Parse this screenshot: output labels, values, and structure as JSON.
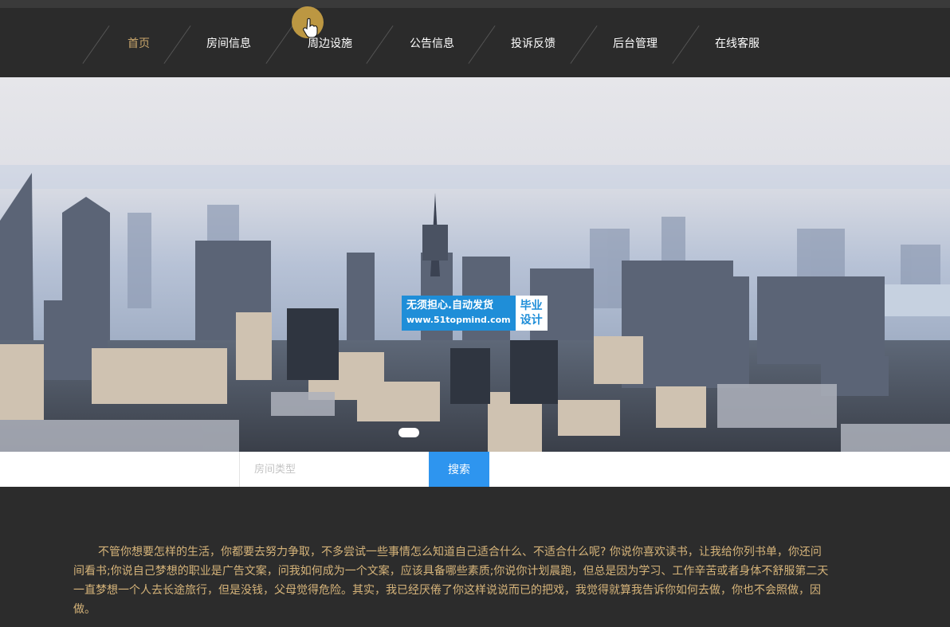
{
  "nav": {
    "items": [
      {
        "label": "首页",
        "active": true
      },
      {
        "label": "房间信息"
      },
      {
        "label": "周边设施"
      },
      {
        "label": "公告信息"
      },
      {
        "label": "投诉反馈"
      },
      {
        "label": "后台管理"
      },
      {
        "label": "在线客服"
      }
    ]
  },
  "watermark": {
    "line1": "无须担心.自动发货",
    "line2": "www.51topmind.com",
    "badge_line1": "毕业",
    "badge_line2": "设计"
  },
  "search": {
    "placeholder": "房间类型",
    "button_label": "搜索"
  },
  "intro": {
    "lines": [
      "不管你想要怎样的生活，你都要去努力争取，不多尝试一些事情怎么知道自己适合什么、不适合什么呢? 你说你喜欢读书，让我给你列书单，你还问",
      "间看书;你说自己梦想的职业是广告文案，问我如何成为一个文案，应该具备哪些素质;你说你计划晨跑，但总是因为学习、工作辛苦或者身体不舒服第二天",
      "一直梦想一个人去长途旅行，但是没钱，父母觉得危险。其实，我已经厌倦了你这样说说而已的把戏，我觉得就算我告诉你如何去做，你也不会照做，因",
      "做。"
    ]
  },
  "colors": {
    "nav_bg": "#2b2b2b",
    "nav_active": "#c9a66b",
    "search_button": "#2e95ef",
    "intro_text": "#d6b47a"
  }
}
